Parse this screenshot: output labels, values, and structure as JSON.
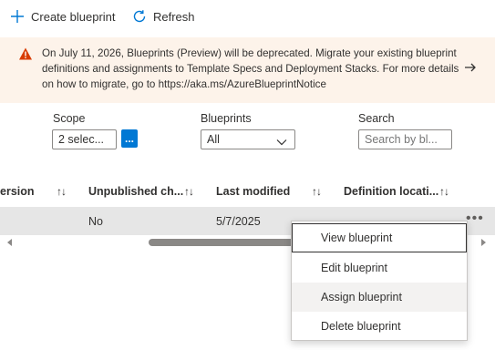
{
  "toolbar": {
    "create_label": "Create blueprint",
    "refresh_label": "Refresh"
  },
  "banner": {
    "message": "On July 11, 2026, Blueprints (Preview) will be deprecated. Migrate your existing blueprint definitions and assignments to Template Specs and Deployment Stacks. For more details on how to migrate, go to https://aka.ms/AzureBlueprintNotice"
  },
  "filters": {
    "scope": {
      "label": "Scope",
      "value": "2 selec...",
      "button": "..."
    },
    "blueprints": {
      "label": "Blueprints",
      "value": "All"
    },
    "search": {
      "label": "Search",
      "placeholder": "Search by bl..."
    }
  },
  "grid": {
    "columns": [
      {
        "label": "ersion"
      },
      {
        "label": "Unpublished ch..."
      },
      {
        "label": "Last modified"
      },
      {
        "label": "Definition locati..."
      }
    ],
    "sort_glyph": "↑↓",
    "rows": [
      {
        "unpublished": "No",
        "last_modified": "5/7/2025",
        "definition_location": "",
        "more": "•••"
      }
    ]
  },
  "context_menu": {
    "items": [
      {
        "label": "View blueprint"
      },
      {
        "label": "Edit blueprint"
      },
      {
        "label": "Assign blueprint"
      },
      {
        "label": "Delete blueprint"
      }
    ]
  },
  "colors": {
    "accent": "#0078d4",
    "warning": "#d83b01",
    "banner_bg": "#fdf3ea"
  }
}
